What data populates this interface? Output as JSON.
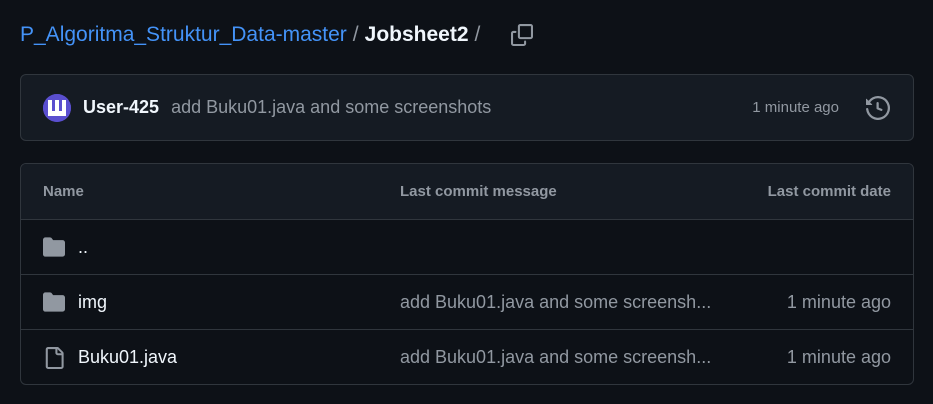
{
  "breadcrumb": {
    "repo": "P_Algoritma_Struktur_Data-master",
    "separator": "/",
    "current": "Jobsheet2",
    "trailing_separator": "/"
  },
  "latest_commit": {
    "user": "User-425",
    "message": "add Buku01.java and some screenshots",
    "time": "1 minute ago"
  },
  "file_table": {
    "headers": {
      "name": "Name",
      "message": "Last commit message",
      "date": "Last commit date"
    },
    "rows": [
      {
        "icon": "folder-icon",
        "name": "..",
        "message": "",
        "date": ""
      },
      {
        "icon": "folder-icon",
        "name": "img",
        "message": "add Buku01.java and some screensh...",
        "date": "1 minute ago"
      },
      {
        "icon": "file-icon",
        "name": "Buku01.java",
        "message": "add Buku01.java and some screensh...",
        "date": "1 minute ago"
      }
    ]
  },
  "colors": {
    "background": "#0d1117",
    "link": "#4493f8",
    "border": "#30363d",
    "muted": "#9198a1",
    "icon": "#9198a1"
  }
}
